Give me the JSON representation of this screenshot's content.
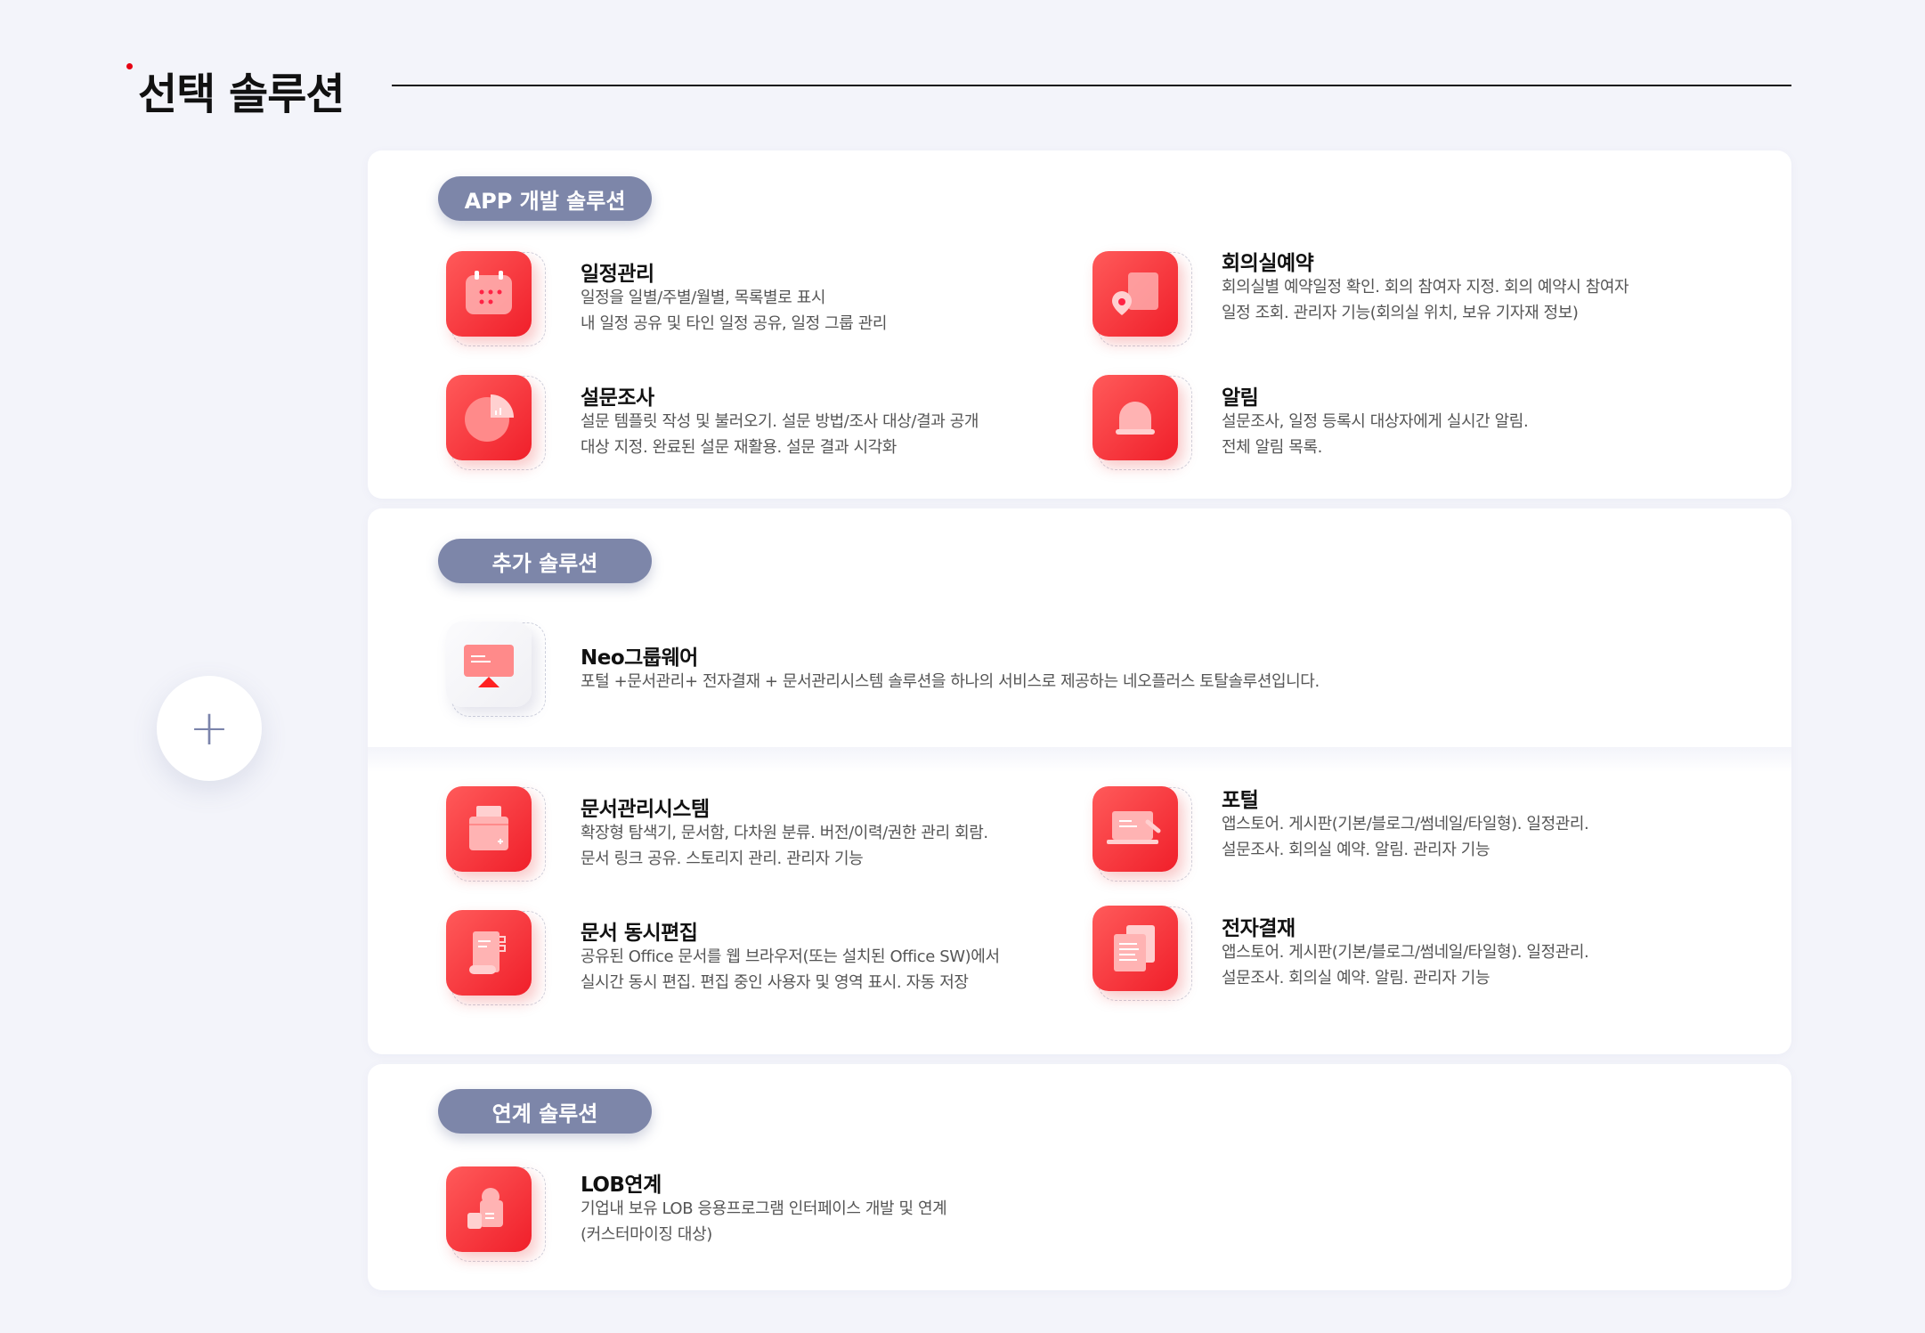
{
  "page": {
    "title": "선택 솔루션"
  },
  "plus_symbol": "+",
  "sections": [
    {
      "label": "APP 개발 솔루션",
      "items": [
        {
          "title": "일정관리",
          "desc_lines": [
            "일정을 일별/주별/월별, 목록별로 표시",
            "내 일정 공유 및 타인 일정 공유, 일정 그룹 관리"
          ],
          "icon": "calendar-icon"
        },
        {
          "title": "회의실예약",
          "desc_lines": [
            "회의실별 예약일정 확인. 회의 참여자 지정. 회의 예약시 참여자",
            "일정 조회. 관리자 기능(회의실 위치, 보유 기자재 정보)"
          ],
          "icon": "meeting-room-icon"
        },
        {
          "title": "설문조사",
          "desc_lines": [
            "설문 템플릿 작성 및 불러오기. 설문 방법/조사 대상/결과 공개",
            "대상 지정. 완료된 설문 재활용. 설문 결과 시각화"
          ],
          "icon": "pie-chart-icon"
        },
        {
          "title": "알림",
          "desc_lines": [
            "설문조사, 일정 등록시 대상자에게 실시간 알림.",
            "전체 알림 목록."
          ],
          "icon": "bell-icon"
        }
      ]
    },
    {
      "label": "추가 솔루션",
      "items": [
        {
          "title": "Neo그룹웨어",
          "desc_lines": [
            "포털 +문서관리+ 전자결재 + 문서관리시스템 솔루션을  하나의 서비스로 제공하는  네오플러스  토탈솔루션입니다."
          ],
          "icon": "monitor-icon"
        },
        {
          "title": "문서관리시스템",
          "desc_lines": [
            "확장형 탐색기, 문서함, 다차원 분류. 버전/이력/권한 관리  회람.",
            "문서 링크 공유. 스토리지 관리. 관리자 기능"
          ],
          "icon": "folder-icon"
        },
        {
          "title": "포털",
          "desc_lines": [
            "앱스토어. 게시판(기본/블로그/썸네일/타일형).  일정관리.",
            "설문조사. 회의실 예약. 알림. 관리자 기능"
          ],
          "icon": "laptop-icon"
        },
        {
          "title": "문서 동시편집",
          "desc_lines": [
            "공유된 Office 문서를 웹 브라우저(또는 설치된 Office SW)에서",
            "실시간 동시 편집. 편집 중인 사용자 및 영역 표시. 자동 저장"
          ],
          "icon": "document-edit-icon"
        },
        {
          "title": "전자결재",
          "desc_lines": [
            "앱스토어. 게시판(기본/블로그/썸네일/타일형).  일정관리.",
            "설문조사. 회의실 예약. 알림. 관리자 기능"
          ],
          "icon": "approval-docs-icon"
        }
      ]
    },
    {
      "label": "연계 솔루션",
      "items": [
        {
          "title": "LOB연계",
          "desc_lines": [
            "기업내 보유 LOB 응용프로그램 인터페이스 개발 및 연계",
            "(커스터마이징 대상)"
          ],
          "icon": "integration-icon"
        }
      ]
    }
  ],
  "colors": {
    "accent_red": "#f5262e",
    "pill_bg": "#7d86a9",
    "title_dot": "#e60012",
    "background": "#f3f4fa"
  }
}
